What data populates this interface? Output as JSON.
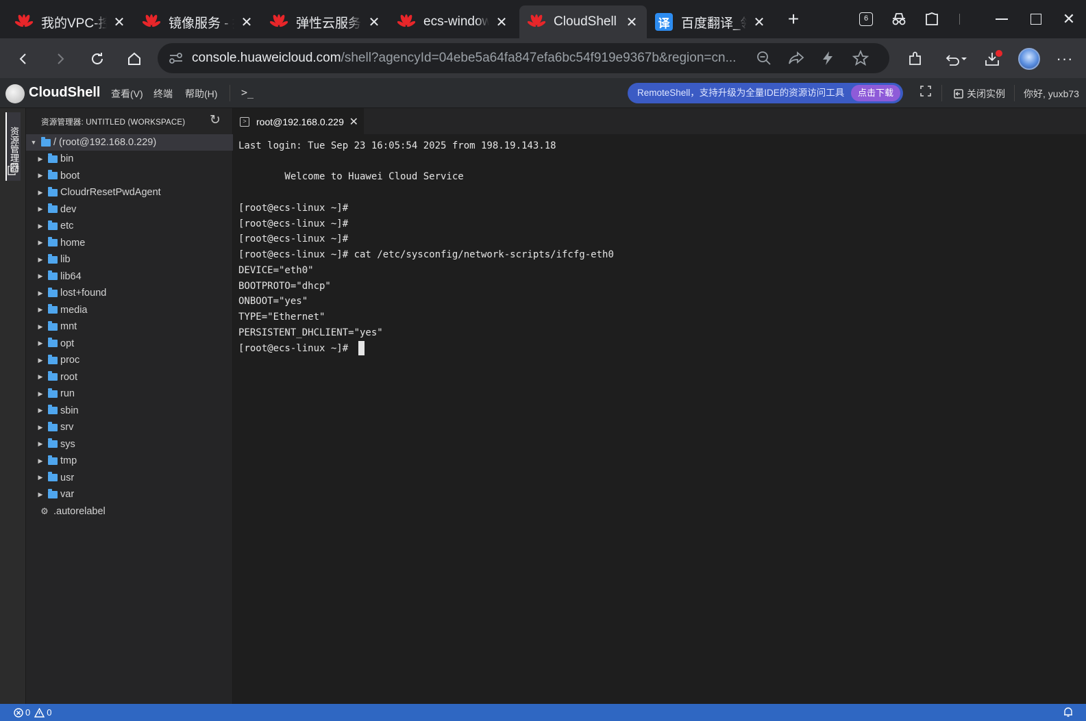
{
  "browser": {
    "tabs": [
      {
        "title": "我的VPC-控制台",
        "icon": "huawei-icon"
      },
      {
        "title": "镜像服务 - 控制台",
        "icon": "huawei-icon"
      },
      {
        "title": "弹性云服务器",
        "icon": "huawei-icon"
      },
      {
        "title": "ecs-windows",
        "icon": "huawei-icon"
      },
      {
        "title": "CloudShell",
        "icon": "huawei-icon",
        "active": true
      },
      {
        "title": "百度翻译_领",
        "icon": "baidu-translate-icon",
        "icon_glyph": "译"
      }
    ],
    "tab_count_badge": "6",
    "url_host": "console.huaweicloud.com",
    "url_path": "/shell?agencyId=04ebe5a64fa847efa6bc54f919e9367b&region=cn..."
  },
  "cloudshell": {
    "title": "CloudShell",
    "menu": {
      "view": "查看(V)",
      "terminal": "终端",
      "help": "帮助(H)"
    },
    "banner": {
      "text": "RemoteShell，支持升级为全量IDE的资源访问工具",
      "action": "点击下载"
    },
    "close_instance": "关闭实例",
    "greeting": "你好, yuxb73"
  },
  "activity": {
    "explorer_label": "资源管理器"
  },
  "explorer": {
    "header": "资源管理器: UNTITLED (WORKSPACE)",
    "root": "/ (root@192.168.0.229)",
    "folders": [
      "bin",
      "boot",
      "CloudrResetPwdAgent",
      "dev",
      "etc",
      "home",
      "lib",
      "lib64",
      "lost+found",
      "media",
      "mnt",
      "opt",
      "proc",
      "root",
      "run",
      "sbin",
      "srv",
      "sys",
      "tmp",
      "usr",
      "var"
    ],
    "files": [
      ".autorelabel"
    ]
  },
  "terminal": {
    "tab_title": "root@192.168.0.229",
    "lines": [
      "Last login: Tue Sep 23 16:05:54 2025 from 198.19.143.18",
      "",
      "        Welcome to Huawei Cloud Service",
      "",
      "[root@ecs-linux ~]#",
      "[root@ecs-linux ~]#",
      "[root@ecs-linux ~]#",
      "[root@ecs-linux ~]# cat /etc/sysconfig/network-scripts/ifcfg-eth0",
      "DEVICE=\"eth0\"",
      "BOOTPROTO=\"dhcp\"",
      "ONBOOT=\"yes\"",
      "TYPE=\"Ethernet\"",
      "PERSISTENT_DHCLIENT=\"yes\"",
      "[root@ecs-linux ~]# "
    ]
  },
  "status": {
    "errors": "0",
    "warnings": "0"
  },
  "colors": {
    "status_bar": "#2f67c2",
    "huawei_red": "#e8262a",
    "banner_blue": "#3b5bc4"
  }
}
